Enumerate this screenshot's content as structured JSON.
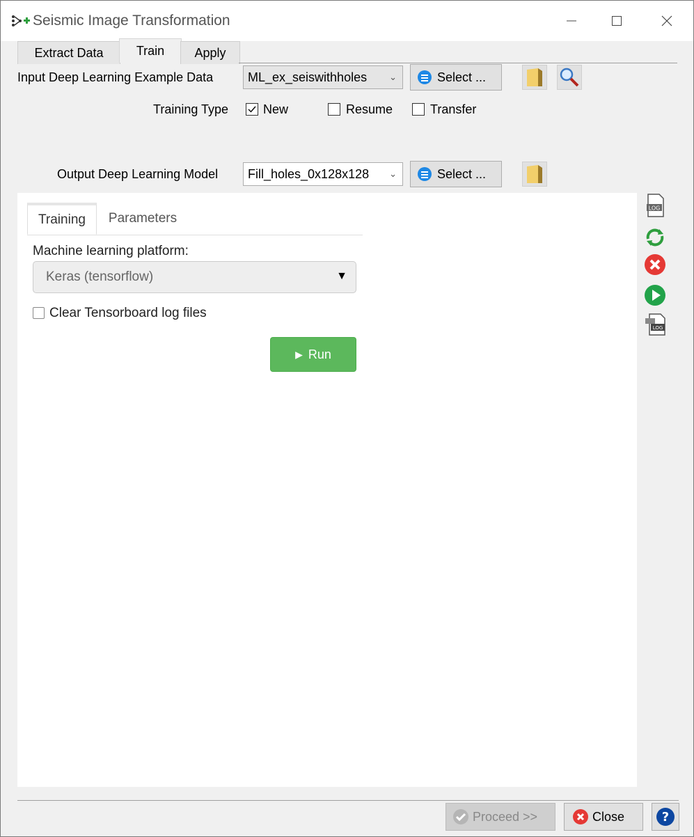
{
  "window": {
    "title": "Seismic Image Transformation"
  },
  "tabs": [
    "Extract Data",
    "Train",
    "Apply"
  ],
  "input": {
    "label": "Input Deep Learning Example Data",
    "value": "ML_ex_seiswithholes",
    "select_label": "Select ..."
  },
  "training_type": {
    "label": "Training Type",
    "options": [
      {
        "label": "New",
        "checked": true
      },
      {
        "label": "Resume",
        "checked": false
      },
      {
        "label": "Transfer",
        "checked": false
      }
    ]
  },
  "output": {
    "label": "Output Deep Learning Model",
    "value": "Fill_holes_0x128x128",
    "select_label": "Select ..."
  },
  "panel": {
    "tabs": [
      "Training",
      "Parameters"
    ],
    "platform_label": "Machine learning platform:",
    "platform_value": "Keras (tensorflow)",
    "clear_logs_label": "Clear Tensorboard log files",
    "clear_logs_checked": false,
    "run_label": "Run"
  },
  "footer": {
    "proceed_label": "Proceed >>",
    "close_label": "Close"
  },
  "colors": {
    "run": "#5cb85c",
    "select_icon": "#1e88e5",
    "close_icon": "#e53935",
    "help": "#0d47a1"
  }
}
